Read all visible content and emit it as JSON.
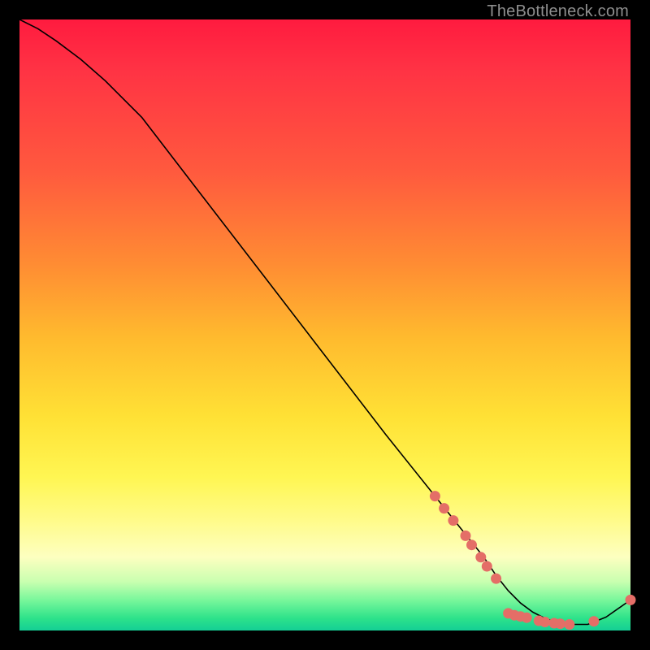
{
  "source_label": "TheBottleneck.com",
  "colors": {
    "dot": "#e46e67",
    "line": "#000000"
  },
  "chart_data": {
    "type": "line",
    "title": "",
    "xlabel": "",
    "ylabel": "",
    "xlim": [
      0,
      100
    ],
    "ylim": [
      0,
      100
    ],
    "grid": false,
    "legend": false,
    "series": [
      {
        "name": "curve",
        "x": [
          0,
          3,
          6,
          10,
          14,
          20,
          30,
          40,
          50,
          60,
          68,
          72,
          76,
          78,
          80,
          82,
          84,
          86,
          88,
          90,
          93,
          96,
          100
        ],
        "y": [
          100,
          98.5,
          96.5,
          93.5,
          90,
          84,
          71,
          58,
          45,
          32,
          22,
          17,
          12,
          9,
          6.5,
          4.5,
          3,
          2,
          1.3,
          1,
          1,
          2.2,
          5
        ]
      }
    ],
    "markers": [
      {
        "x": 68,
        "y": 22
      },
      {
        "x": 69.5,
        "y": 20
      },
      {
        "x": 71,
        "y": 18
      },
      {
        "x": 73,
        "y": 15.5
      },
      {
        "x": 74,
        "y": 14
      },
      {
        "x": 75.5,
        "y": 12
      },
      {
        "x": 76.5,
        "y": 10.5
      },
      {
        "x": 78,
        "y": 8.5
      },
      {
        "x": 80,
        "y": 2.8
      },
      {
        "x": 81,
        "y": 2.5
      },
      {
        "x": 82,
        "y": 2.3
      },
      {
        "x": 83,
        "y": 2.1
      },
      {
        "x": 85,
        "y": 1.6
      },
      {
        "x": 86,
        "y": 1.4
      },
      {
        "x": 87.5,
        "y": 1.2
      },
      {
        "x": 88.5,
        "y": 1.1
      },
      {
        "x": 90,
        "y": 1.0
      },
      {
        "x": 94,
        "y": 1.5
      },
      {
        "x": 100,
        "y": 5
      }
    ]
  }
}
